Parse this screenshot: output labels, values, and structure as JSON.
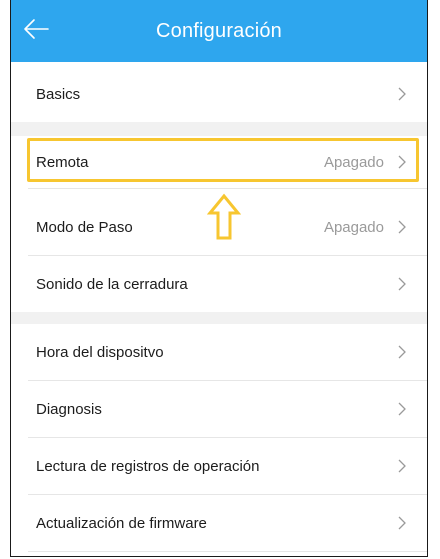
{
  "header": {
    "title": "Configuración",
    "back_icon": "arrow-left-icon",
    "color": "#2ea6ee"
  },
  "rows": [
    {
      "label": "Basics",
      "value": ""
    },
    {
      "label": "Remota",
      "value": "Apagado"
    },
    {
      "label": "Modo de Paso",
      "value": "Apagado"
    },
    {
      "label": "Sonido de la cerradura",
      "value": ""
    },
    {
      "label": "Hora del dispositvo",
      "value": ""
    },
    {
      "label": "Diagnosis",
      "value": ""
    },
    {
      "label": "Lectura de registros de operación",
      "value": ""
    },
    {
      "label": "Actualización de firmware",
      "value": ""
    }
  ],
  "annotation": {
    "highlight_color": "#f7c630",
    "pointer_icon": "arrow-up-outline-icon"
  }
}
